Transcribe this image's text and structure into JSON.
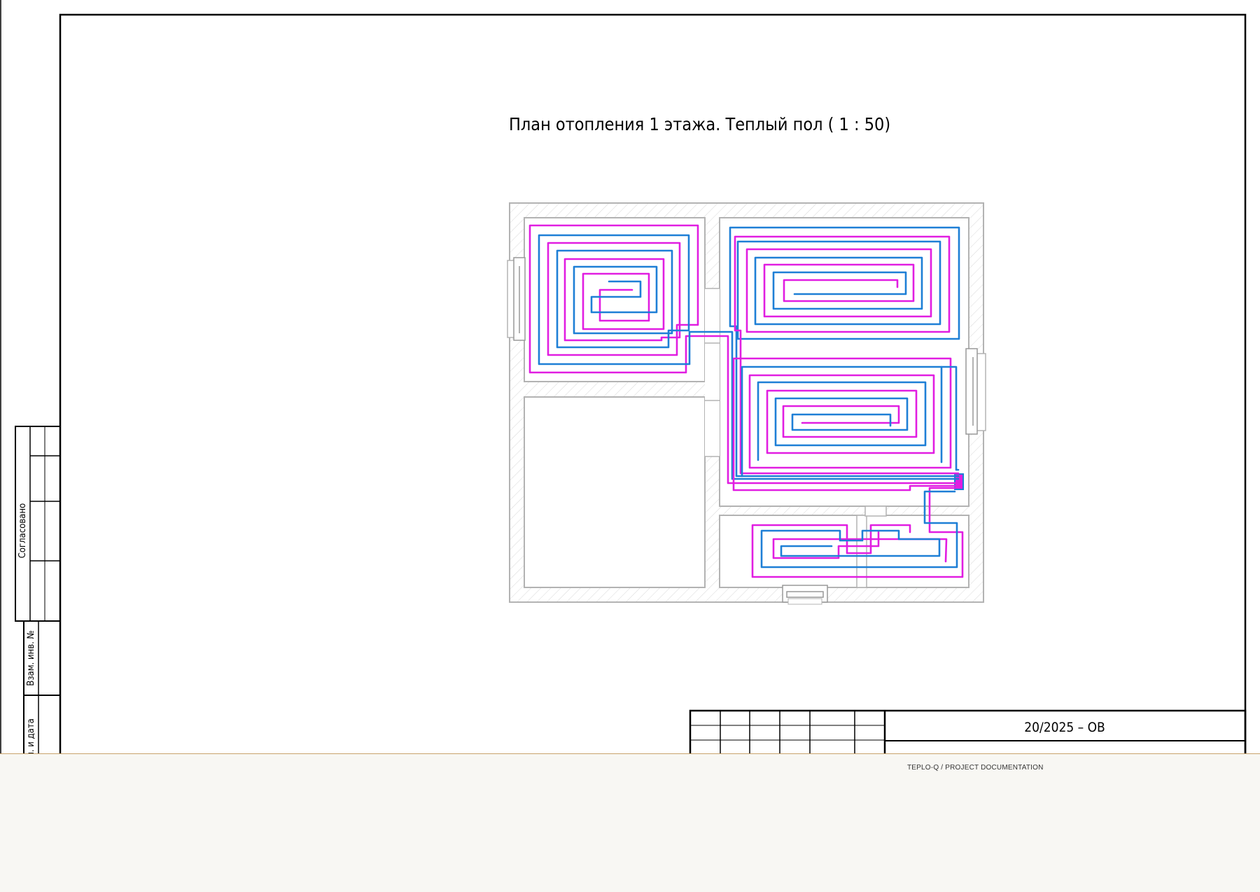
{
  "drawing": {
    "title": "План отопления 1 этажа. Теплый пол ( 1 : 50)",
    "doc_code": "20/2025 – ОВ",
    "side_labels": {
      "agreed": "Согласовано",
      "inv_no": "Взам. инв. №",
      "sign_date": "Подп. и дата"
    }
  },
  "colors": {
    "loop_supply": "#e11ee1",
    "loop_return": "#1e7fd6",
    "wall": "#b3b3b3",
    "frame": "#000000"
  },
  "footer": {
    "text": "TEPLO-Q / PROJECT DOCUMENTATION"
  }
}
